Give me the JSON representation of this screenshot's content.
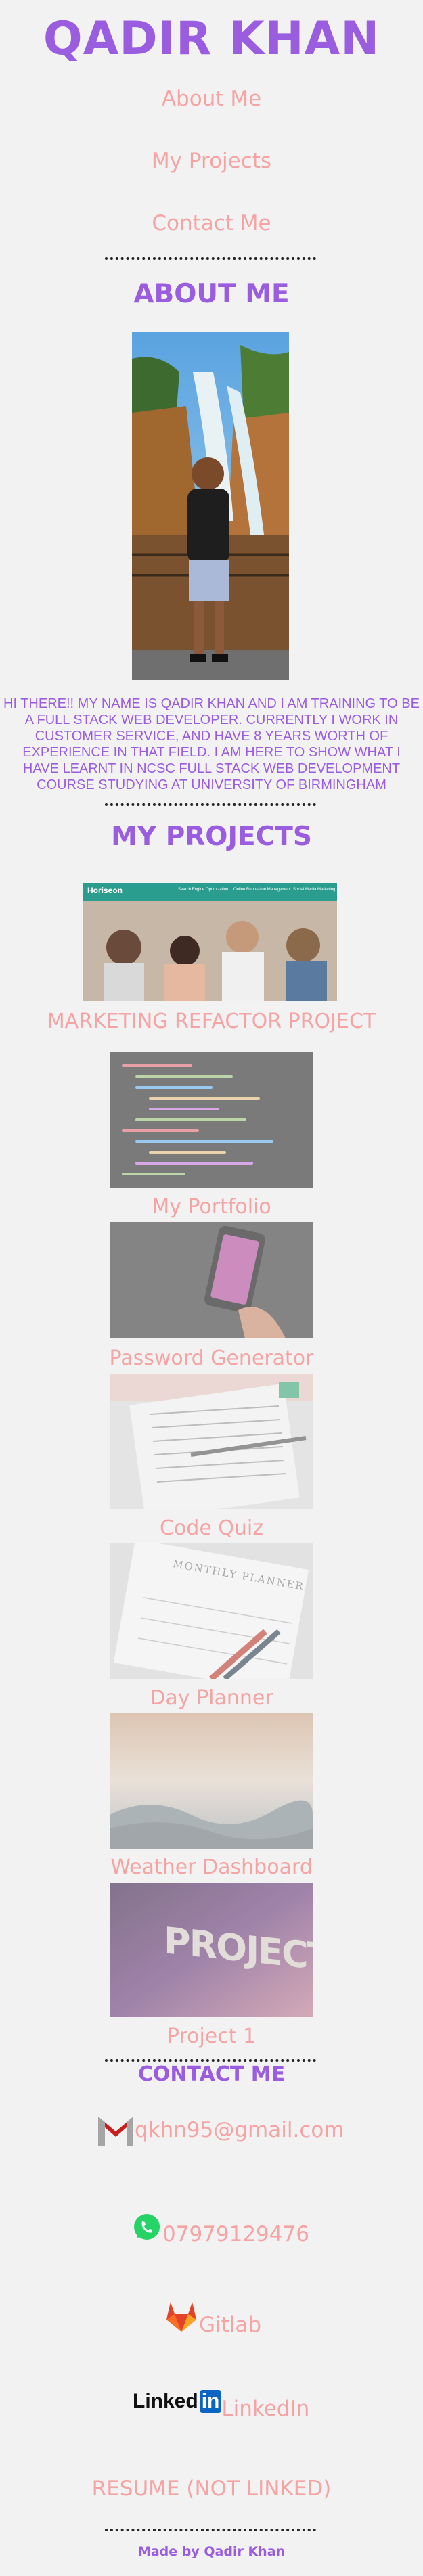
{
  "header": {
    "title": "QADIR KHAN",
    "nav": [
      {
        "label": "About Me"
      },
      {
        "label": "My Projects"
      },
      {
        "label": "Contact Me"
      }
    ]
  },
  "about": {
    "heading": "ABOUT ME",
    "bio": "HI THERE!! MY NAME IS QADIR KHAN AND I AM TRAINING TO BE A FULL STACK WEB DEVELOPER. CURRENTLY I WORK IN CUSTOMER SERVICE, AND HAVE 8 YEARS WORTH OF EXPERIENCE IN THAT FIELD. I AM HERE TO SHOW WHAT I HAVE LEARNT IN NCSC FULL STACK WEB DEVELOPMENT COURSE STUDYING AT UNIVERSITY OF BIRMINGHAM"
  },
  "projects": {
    "heading": "MY PROJECTS",
    "featured": {
      "label": "MARKETING REFACTOR PROJECT",
      "thumb_brand": "Horiseon",
      "thumb_nav": [
        "Search Engine Optimization",
        "Online Reputation Management",
        "Social Media Marketing"
      ]
    },
    "items": [
      {
        "label": "My Portfolio"
      },
      {
        "label": "Password Generator"
      },
      {
        "label": "Code Quiz"
      },
      {
        "label": "Day Planner",
        "thumb_text": "MONTHLY PLANNER"
      },
      {
        "label": "Weather Dashboard"
      },
      {
        "label": "Project 1",
        "thumb_text": "PROJECTS"
      }
    ]
  },
  "contact": {
    "heading": "CONTACT ME",
    "email": "qkhn95@gmail.com",
    "phone": "07979129476",
    "gitlab": "Gitlab",
    "linkedin": "LinkedIn",
    "linkedin_logo": "Linked",
    "linkedin_logo_in": "in",
    "resume": "RESUME (NOT LINKED)"
  },
  "footer": {
    "text": "Made by Qadir Khan"
  },
  "colors": {
    "accent_purple": "#9b5de0",
    "link_pink": "#f5a3a3",
    "background": "#f2f2f2"
  }
}
